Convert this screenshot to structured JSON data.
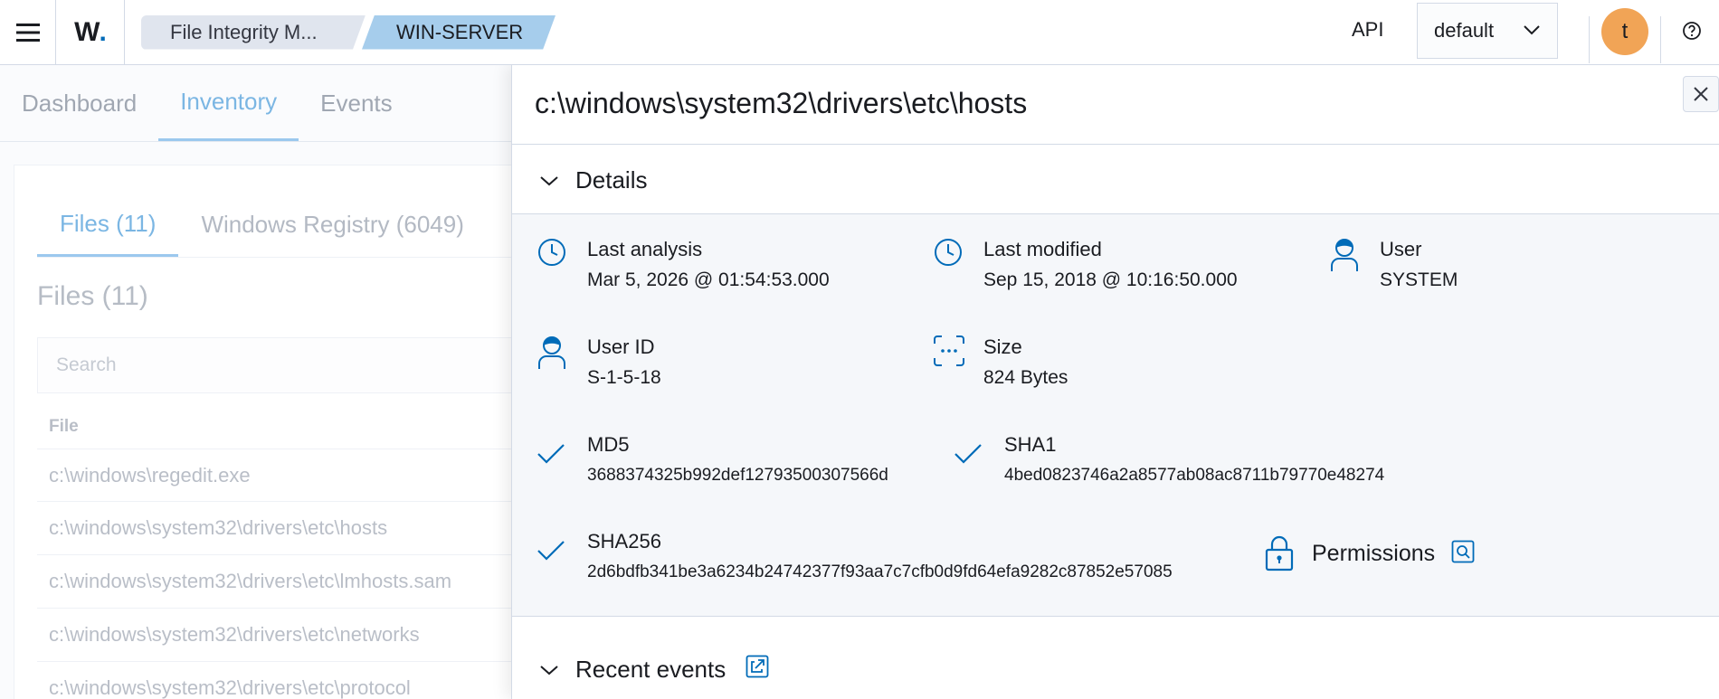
{
  "header": {
    "logo_text": "W",
    "logo_dot": ".",
    "breadcrumbs": [
      "File Integrity M...",
      "WIN-SERVER"
    ],
    "api_label": "API",
    "selector_value": "default",
    "avatar_initial": "t"
  },
  "nav": {
    "tabs": [
      "Dashboard",
      "Inventory",
      "Events"
    ],
    "active_tab": "Inventory"
  },
  "inventory": {
    "tabs": [
      "Files (11)",
      "Windows Registry (6049)"
    ],
    "files_title": "Files (11)",
    "search_placeholder": "Search",
    "column_file": "File",
    "rows": [
      "c:\\windows\\regedit.exe",
      "c:\\windows\\system32\\drivers\\etc\\hosts",
      "c:\\windows\\system32\\drivers\\etc\\lmhosts.sam",
      "c:\\windows\\system32\\drivers\\etc\\networks",
      "c:\\windows\\system32\\drivers\\etc\\protocol"
    ]
  },
  "flyout": {
    "title": "c:\\windows\\system32\\drivers\\etc\\hosts",
    "details_label": "Details",
    "fields": {
      "last_analysis": {
        "label": "Last analysis",
        "value": "Mar 5, 2026 @ 01:54:53.000"
      },
      "last_modified": {
        "label": "Last modified",
        "value": "Sep 15, 2018 @ 10:16:50.000"
      },
      "user": {
        "label": "User",
        "value": "SYSTEM"
      },
      "user_id": {
        "label": "User ID",
        "value": "S-1-5-18"
      },
      "size": {
        "label": "Size",
        "value": "824 Bytes"
      },
      "md5": {
        "label": "MD5",
        "value": "3688374325b992def12793500307566d"
      },
      "sha1": {
        "label": "SHA1",
        "value": "4bed0823746a2a8577ab08ac8711b79770e48274"
      },
      "sha256": {
        "label": "SHA256",
        "value": "2d6bdfb341be3a6234b24742377f93aa7c7cfb0d9fd64efa9282c87852e57085"
      }
    },
    "permissions_label": "Permissions",
    "recent_events_label": "Recent events"
  },
  "colors": {
    "accent": "#006bb8",
    "breadcrumb_active": "#a6cdec",
    "breadcrumb_inactive": "#e0e5ee",
    "avatar": "#f1a456",
    "details_bg": "#f5f7fa"
  },
  "icons": {
    "menu": "hamburger-icon",
    "select": "chevron-down-icon",
    "help": "help-icon",
    "close": "close-icon",
    "section_toggle": "chevron-down-icon",
    "clock": "clock-icon",
    "user": "user-icon",
    "size": "size-icon",
    "check": "check-icon",
    "lock": "lock-icon",
    "inspect": "inspect-icon",
    "external": "external-link-icon"
  }
}
